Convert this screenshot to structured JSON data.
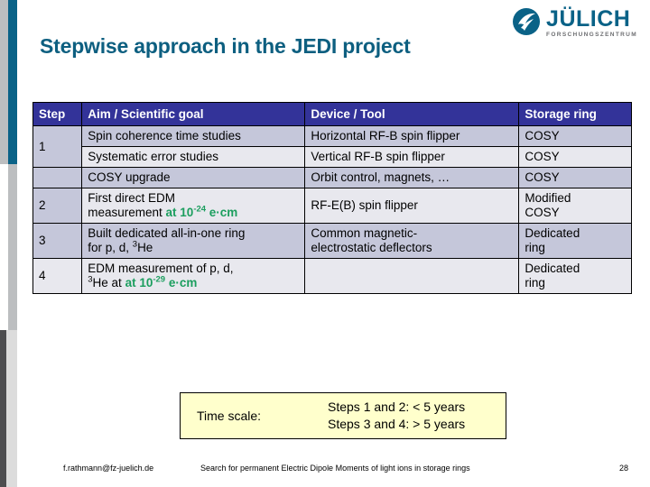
{
  "logo": {
    "mark_icon": "juelich-swirl-icon",
    "name": "JÜLICH",
    "subtitle": "FORSCHUNGSZENTRUM",
    "color": "#0a6287"
  },
  "title": "Stepwise approach in the JEDI project",
  "theme": {
    "title_color": "#0d5f80",
    "accent_bar": "#0a6287",
    "table_header_bg": "#333399",
    "row_shade_a": "#c5c7da",
    "row_shade_b": "#e8e8ee",
    "highlight_green": "#1b9e5e",
    "note_bg": "#ffffcc"
  },
  "table": {
    "headers": [
      "Step",
      "Aim / Scientific goal",
      "Device / Tool",
      "Storage ring"
    ],
    "rows": [
      {
        "step": "1",
        "aim": "Spin coherence time studies",
        "device": "Horizontal RF-B spin flipper",
        "ring": "COSY"
      },
      {
        "step": "",
        "aim": "Systematic error studies",
        "device": "Vertical RF-B spin  flipper",
        "ring": "COSY"
      },
      {
        "step": "",
        "aim": "COSY upgrade",
        "device": "Orbit control, magnets, …",
        "ring": "COSY"
      },
      {
        "step": "2",
        "aim_line1": "First direct EDM",
        "aim_line2_plain": "measurement ",
        "aim_line2_green": "at 10",
        "aim_line2_green_sup": "-24",
        "aim_line2_green_tail": " e·cm",
        "device": "RF-E(B) spin flipper",
        "ring_line1": "Modified",
        "ring_line2": "COSY"
      },
      {
        "step": "3",
        "aim_line1": "Built dedicated all-in-one ring",
        "aim_line2_plain": "for p, d, ",
        "aim_line2_sup": "3",
        "aim_line2_tail": "He",
        "device_line1": "Common magnetic-",
        "device_line2": "electrostatic deflectors",
        "ring_line1": "Dedicated",
        "ring_line2": "ring"
      },
      {
        "step": "4",
        "aim_line1": "EDM measurement of p, d,",
        "aim_line2_sup": "3",
        "aim_line2_plain": "He at ",
        "aim_line2_green": "at 10",
        "aim_line2_green_sup": "-29",
        "aim_line2_green_tail": " e·cm",
        "device": "",
        "ring_line1": "Dedicated",
        "ring_line2": "ring"
      }
    ]
  },
  "time_scale": {
    "label": "Time scale:",
    "line1": "Steps 1 and 2: < 5 years",
    "line2": "Steps 3 and 4: > 5 years"
  },
  "footer": {
    "email": "f.rathmann@fz-juelich.de",
    "center": "Search for permanent Electric Dipole Moments of light ions in storage rings",
    "page": "28"
  }
}
